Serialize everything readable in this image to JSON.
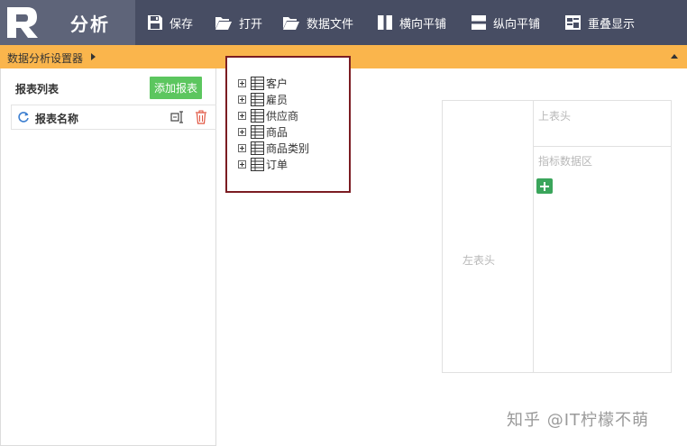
{
  "app": {
    "logo_letter": "R",
    "module_title": "分析"
  },
  "toolbar": {
    "save": "保存",
    "open": "打开",
    "data_file": "数据文件",
    "tile_horizontal": "横向平铺",
    "tile_vertical": "纵向平铺",
    "cascade": "重叠显示"
  },
  "subbar": {
    "title": "数据分析设置器"
  },
  "report_list": {
    "title": "报表列表",
    "add_button": "添加报表",
    "items": [
      {
        "name": "报表名称"
      }
    ]
  },
  "tree": {
    "items": [
      {
        "label": "客户"
      },
      {
        "label": "雇员"
      },
      {
        "label": "供应商"
      },
      {
        "label": "商品"
      },
      {
        "label": "商品类别"
      },
      {
        "label": "订单"
      }
    ]
  },
  "pivot": {
    "top_header": "上表头",
    "metric_area": "指标数据区",
    "left_header": "左表头"
  },
  "watermark": "知乎 @IT柠檬不萌",
  "colors": {
    "toolbar_bg": "#474d63",
    "logo_bg": "#5e6479",
    "subbar_bg": "#fab54c",
    "add_button": "#5cc65f",
    "tree_highlight": "#7b1c22",
    "pivot_add": "#3aa55b"
  }
}
